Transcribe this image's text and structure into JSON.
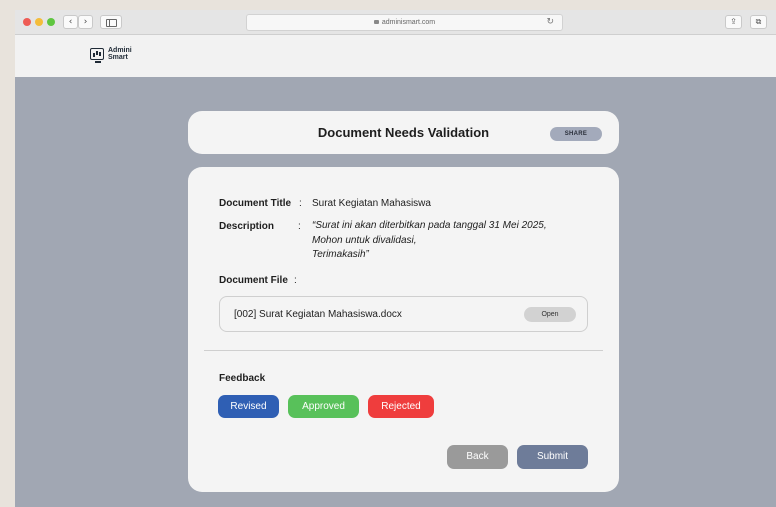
{
  "browser": {
    "url": "adminismart.com",
    "back_glyph": "‹",
    "forward_glyph": "›",
    "reload_glyph": "↻",
    "share_glyph": "⇪",
    "tabs_glyph": "⧉"
  },
  "brand": {
    "line1": "Admini",
    "line2": "Smart"
  },
  "header": {
    "title": "Document Needs Validation",
    "share_label": "SHARE"
  },
  "document": {
    "title_label": "Document Title",
    "title_value": "Surat Kegiatan Mahasiswa",
    "description_label": "Description",
    "description_lines": [
      "“Surat ini akan diterbitkan pada tanggal 31 Mei 2025,",
      "Mohon untuk divalidasi,",
      "Terimakasih”"
    ],
    "file_label": "Document File",
    "file_name": "[002] Surat Kegiatan Mahasiswa.docx",
    "open_label": "Open",
    "colon": ":"
  },
  "feedback": {
    "label": "Feedback",
    "options": [
      "Revised",
      "Approved",
      "Rejected"
    ]
  },
  "actions": {
    "back_label": "Back",
    "submit_label": "Submit"
  },
  "colors": {
    "revised": "#2f5fb4",
    "approved": "#58c15a",
    "rejected": "#ef3d3d",
    "submit": "#6e7c99",
    "back": "#9a9a9a",
    "background": "#a1a7b3"
  }
}
